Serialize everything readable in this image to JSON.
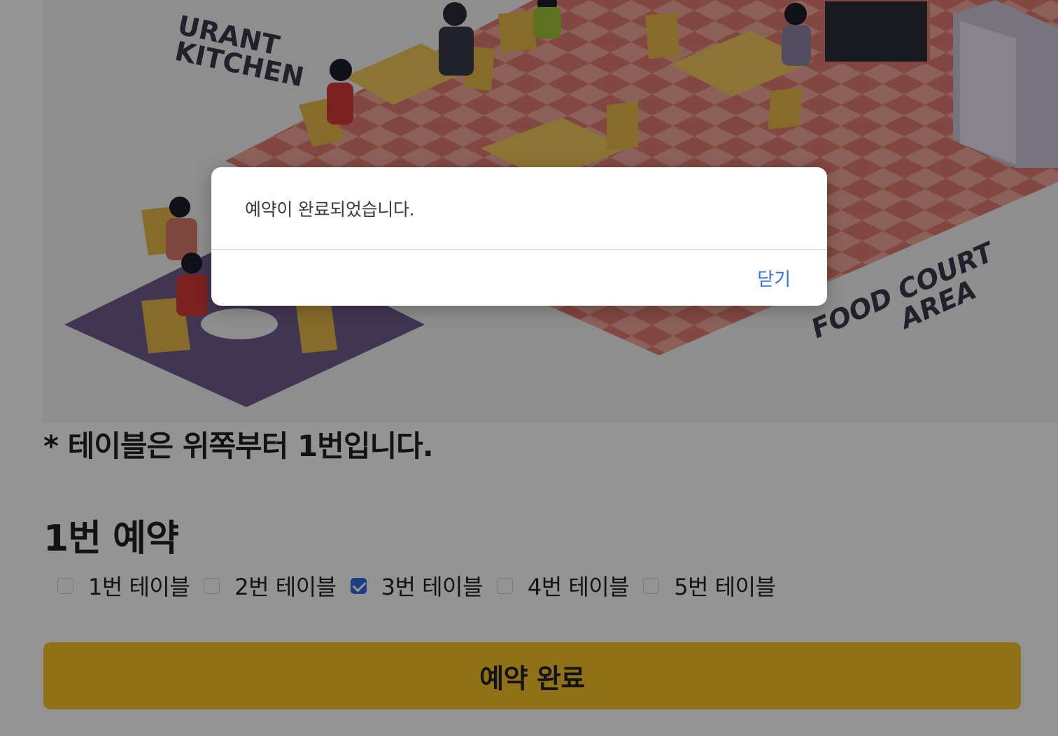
{
  "illustration": {
    "sign_kitchen_top": "URANT",
    "sign_kitchen": "KITCHEN",
    "sign_food_court_1": "FOOD COURT",
    "sign_food_court_2": "AREA"
  },
  "note": "* 테이블은 위쪽부터 1번입니다.",
  "reservation": {
    "heading": "1번 예약",
    "tables": [
      {
        "label": "1번 테이블",
        "checked": false
      },
      {
        "label": "2번 테이블",
        "checked": false
      },
      {
        "label": "3번 테이블",
        "checked": true
      },
      {
        "label": "4번 테이블",
        "checked": false
      },
      {
        "label": "5번 테이블",
        "checked": false
      }
    ],
    "submit_label": "예약 완료"
  },
  "modal": {
    "message": "예약이 완료되었습니다.",
    "close_label": "닫기"
  },
  "colors": {
    "accent_button": "#f7c52a",
    "checkbox_checked": "#2f6fe0",
    "link_blue": "#2f74e6"
  }
}
